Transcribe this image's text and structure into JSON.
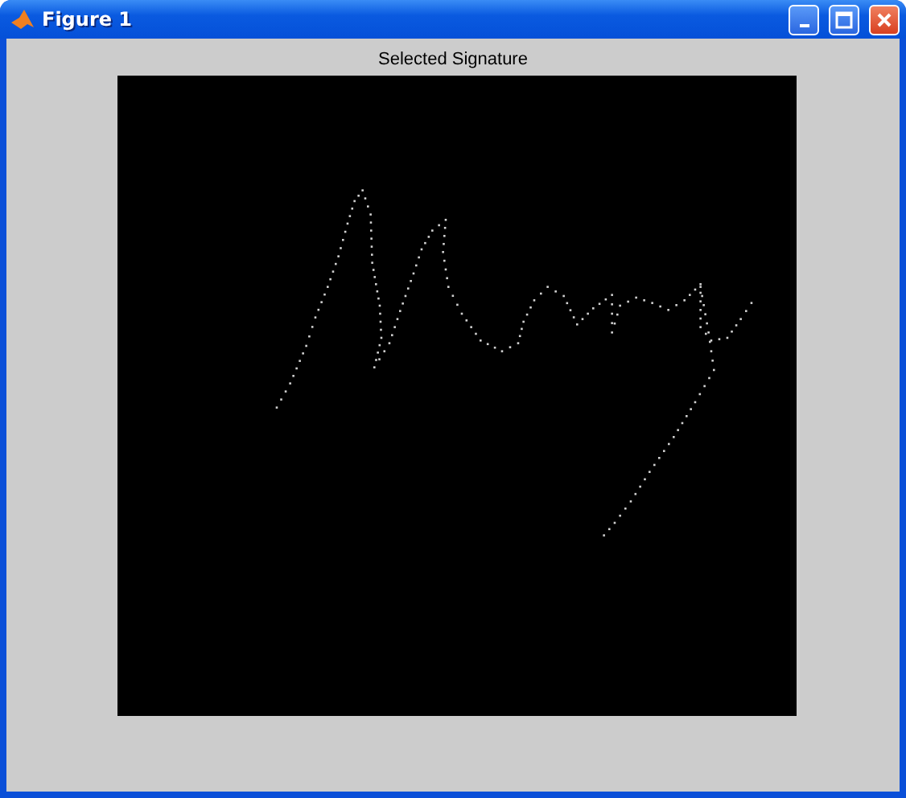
{
  "window": {
    "title": "Figure 1"
  },
  "axes": {
    "title": "Selected Signature"
  }
}
